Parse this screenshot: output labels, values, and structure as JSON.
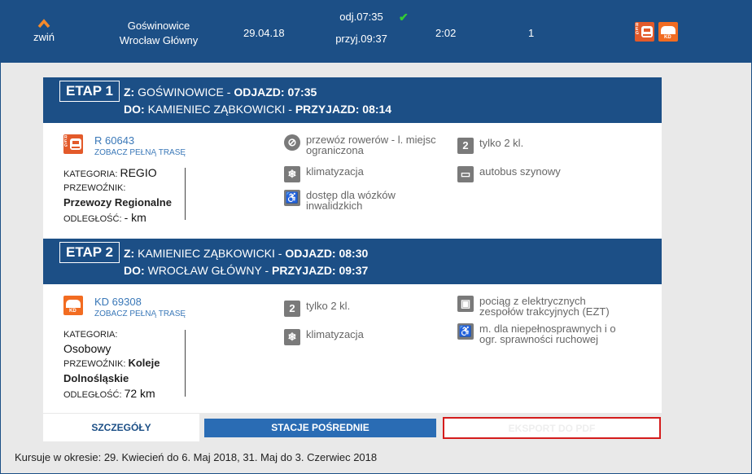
{
  "summary": {
    "collapse_label": "zwiń",
    "from_station": "Goświnowice",
    "to_station": "Wrocław Główny",
    "date": "29.04.18",
    "departure": "odj.07:35",
    "arrival": "przyj.09:37",
    "duration": "2:02",
    "changes": "1"
  },
  "stages": [
    {
      "badge": "ETAP 1",
      "from_prefix": "Z:",
      "from": "GOŚWINOWICE",
      "dep_label": "ODJAZD: 07:35",
      "to_prefix": "DO:",
      "to": "KAMIENIEC ZĄBKOWICKI",
      "arr_label": "PRZYJAZD: 08:14",
      "train_number": "R 60643",
      "route_link": "ZOBACZ PEŁNĄ TRASĘ",
      "category_label": "KATEGORIA:",
      "category": "REGIO",
      "carrier_label": "PRZEWOŹNIK:",
      "carrier": "Przewozy Regionalne",
      "distance_label": "ODLEGŁOŚĆ:",
      "distance": "- km",
      "features": {
        "bikes": "przewóz rowerów - l. miejsc ograniczona",
        "ac": "klimatyzacja",
        "wheelchair": "dostęp dla wózków inwalidzkich",
        "second_class": "tylko 2 kl.",
        "railbus": "autobus szynowy"
      }
    },
    {
      "badge": "ETAP 2",
      "from_prefix": "Z:",
      "from": "KAMIENIEC ZĄBKOWICKI",
      "dep_label": "ODJAZD: 08:30",
      "to_prefix": "DO:",
      "to": "WROCŁAW GŁÓWNY",
      "arr_label": "PRZYJAZD: 09:37",
      "train_number": "KD 69308",
      "route_link": "ZOBACZ PEŁNĄ TRASĘ",
      "category_label": "KATEGORIA:",
      "category": "Osobowy",
      "carrier_label": "PRZEWOŹNIK:",
      "carrier": "Koleje Dolnośląskie",
      "distance_label": "ODLEGŁOŚĆ:",
      "distance": "72 km",
      "features": {
        "second_class": "tylko 2 kl.",
        "ac": "klimatyzacja",
        "ezt": "pociąg z elektrycznych zespołów trakcyjnych (EZT)",
        "disabled": "m. dla niepełnosprawnych i o ogr. sprawności ruchowej"
      }
    }
  ],
  "tabs": {
    "details": "SZCZEGÓŁY",
    "stations": "STACJE POŚREDNIE",
    "pdf": "EKSPORT DO PDF"
  },
  "period": "Kursuje w okresie: 29. Kwiecień do 6. Maj 2018, 31. Maj do 3. Czerwiec 2018",
  "colors": {
    "brand_blue": "#1c4f86",
    "link_blue": "#3a78b8",
    "accent_orange": "#f58a2c",
    "check_green": "#33cc33",
    "pdf_border": "#d41c1c"
  },
  "icons": {
    "collapse": "chevron-up-icon",
    "check": "check-icon",
    "regio": "regio-operator-icon",
    "kd": "kd-operator-icon",
    "bike": "bicycle-icon",
    "ac": "snowflake-icon",
    "wheelchair": "wheelchair-icon",
    "second_class": "second-class-icon",
    "railbus": "railbus-icon",
    "ezt": "electric-train-icon",
    "disabled": "reduced-mobility-icon"
  }
}
